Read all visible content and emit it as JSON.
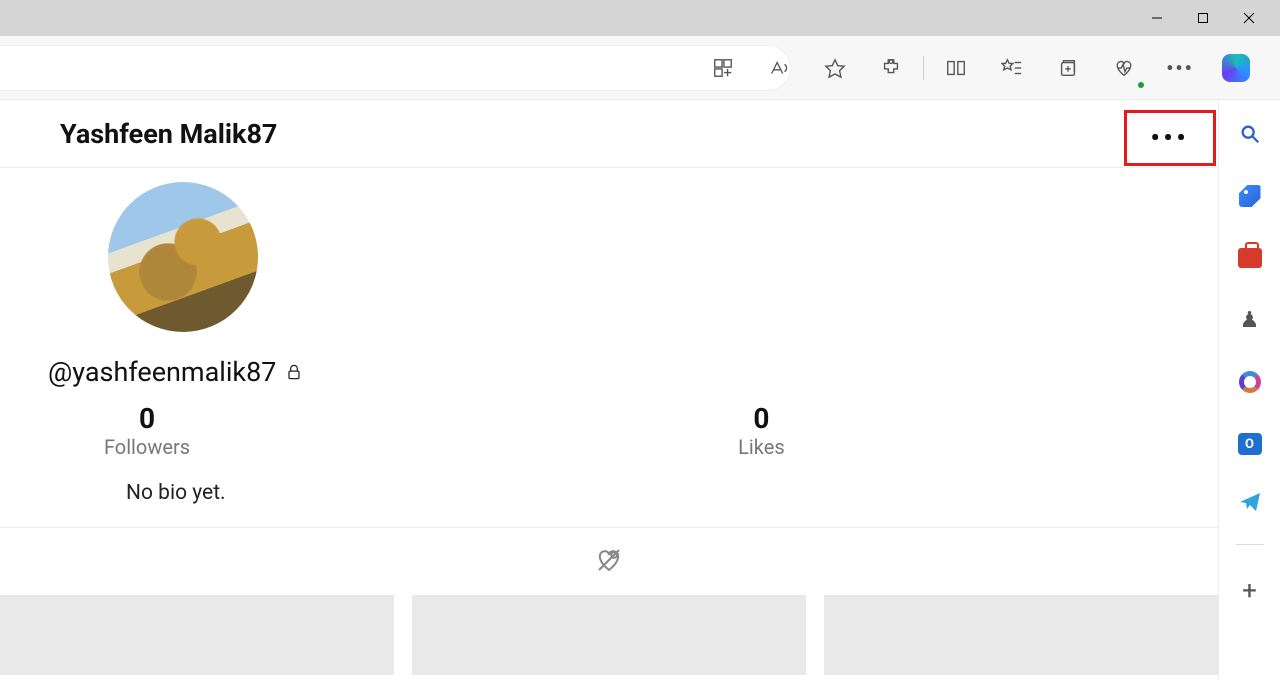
{
  "window": {
    "title": ""
  },
  "profile": {
    "display_name": "Yashfeen Malik87",
    "handle": "@yashfeenmalik87",
    "bio": "No bio yet.",
    "private": true
  },
  "stats": {
    "followers": {
      "count": "0",
      "label": "Followers"
    },
    "likes": {
      "count": "0",
      "label": "Likes"
    }
  },
  "header": {
    "more_label": "•••"
  },
  "browser_toolbar": {
    "more_label": "•••"
  }
}
